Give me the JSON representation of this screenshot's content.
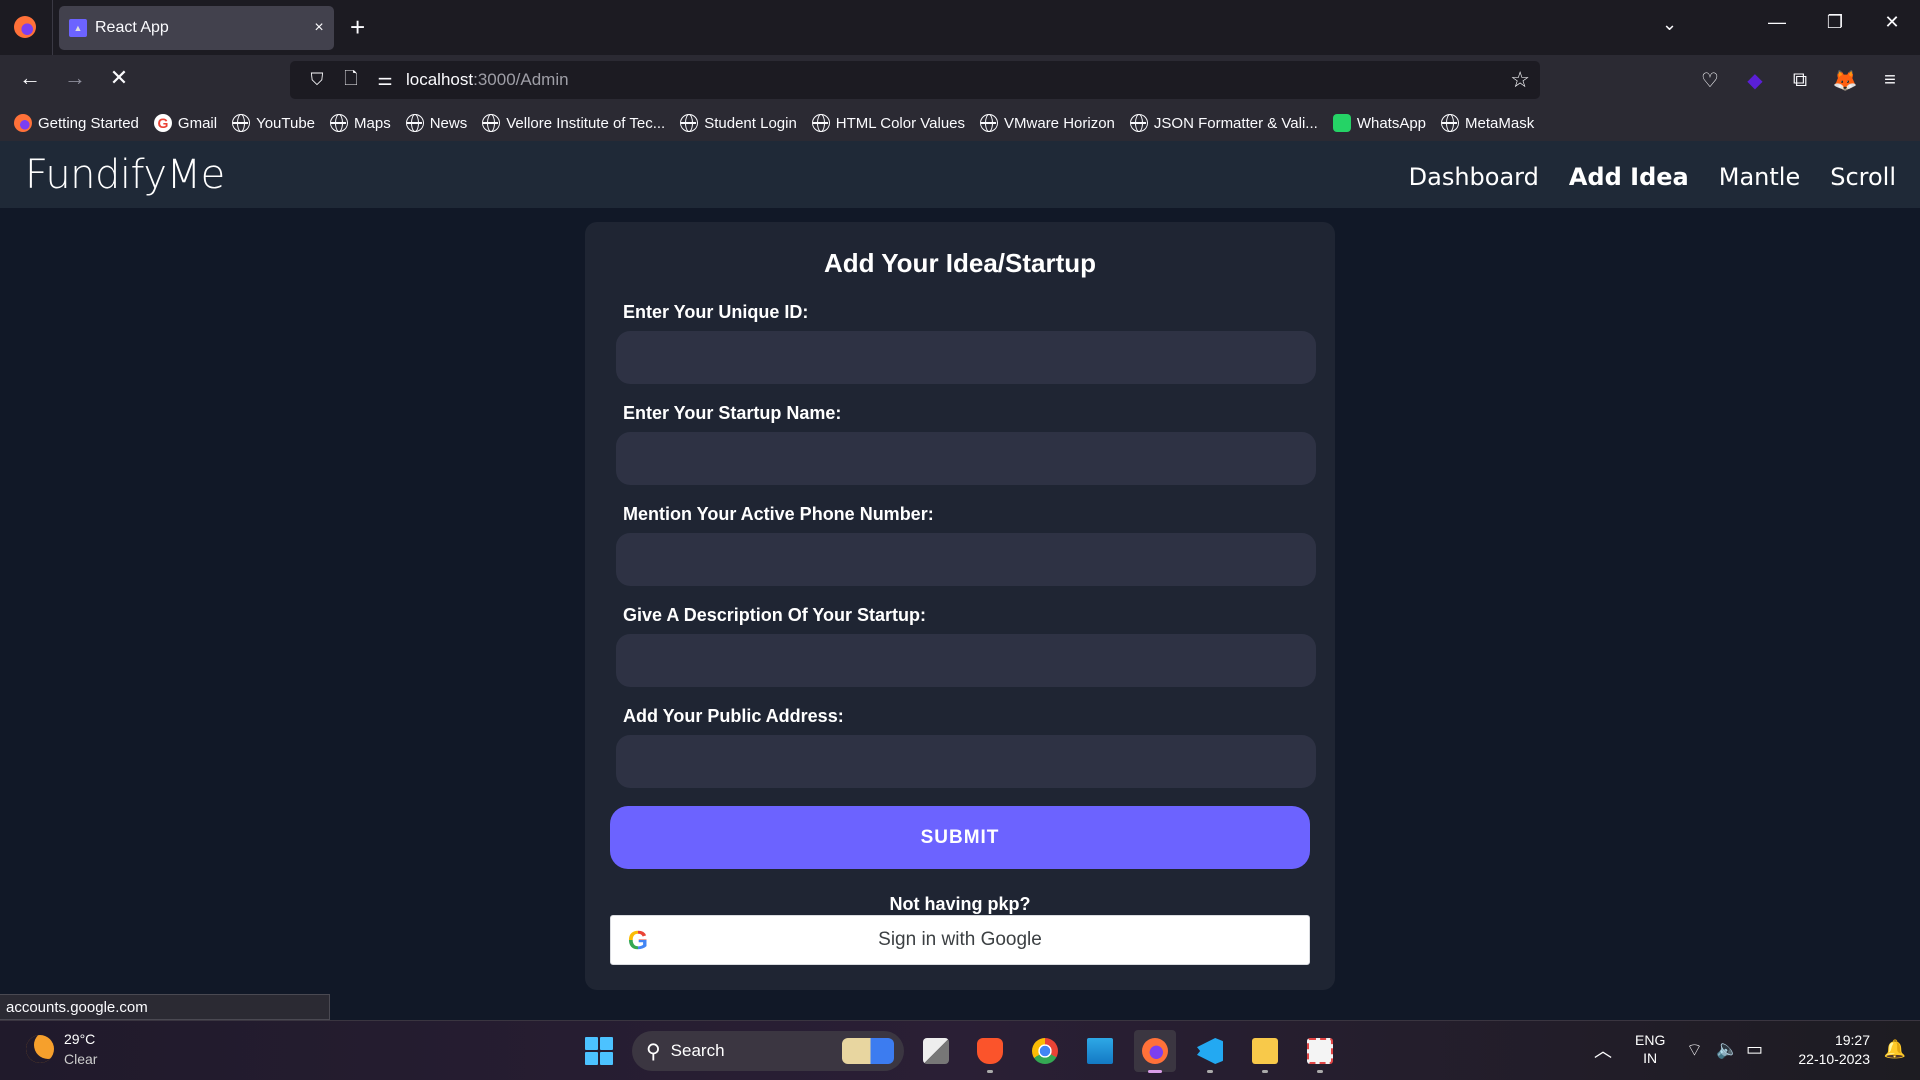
{
  "browser": {
    "tab": {
      "title": "React App",
      "close_icon": "×"
    },
    "new_tab_icon": "+",
    "url": {
      "host": "localhost",
      "path": ":3000/Admin"
    },
    "bookmarks": [
      {
        "label": "Getting Started",
        "icon": "firefox-icon"
      },
      {
        "label": "Gmail",
        "icon": "google-icon"
      },
      {
        "label": "YouTube",
        "icon": "globe-icon"
      },
      {
        "label": "Maps",
        "icon": "globe-icon"
      },
      {
        "label": "News",
        "icon": "globe-icon"
      },
      {
        "label": "Vellore Institute of Tec...",
        "icon": "globe-icon"
      },
      {
        "label": "Student Login",
        "icon": "globe-icon"
      },
      {
        "label": "HTML Color Values",
        "icon": "globe-icon"
      },
      {
        "label": "VMware Horizon",
        "icon": "globe-icon"
      },
      {
        "label": "JSON Formatter & Vali...",
        "icon": "globe-icon"
      },
      {
        "label": "WhatsApp",
        "icon": "whatsapp-icon"
      },
      {
        "label": "MetaMask",
        "icon": "globe-icon"
      }
    ],
    "status_link": "accounts.google.com"
  },
  "app": {
    "brand": "FundifyMe",
    "nav": [
      {
        "label": "Dashboard",
        "active": false
      },
      {
        "label": "Add Idea",
        "active": true
      },
      {
        "label": "Mantle",
        "active": false
      },
      {
        "label": "Scroll",
        "active": false
      }
    ],
    "form": {
      "title": "Add Your Idea/Startup",
      "fields": [
        {
          "label": "Enter Your Unique ID:",
          "value": "",
          "placeholder": ""
        },
        {
          "label": "Enter Your Startup Name:",
          "value": "",
          "placeholder": ""
        },
        {
          "label": "Mention Your Active Phone Number:",
          "value": "",
          "placeholder": ""
        },
        {
          "label": "Give A Description Of Your Startup:",
          "value": "",
          "placeholder": ""
        },
        {
          "label": "Add Your Public Address:",
          "value": "",
          "placeholder": ""
        }
      ],
      "submit_label": "SUBMIT",
      "alt_prompt": "Not having pkp?",
      "google_label": "Sign in with Google",
      "google_glyph": "G"
    }
  },
  "colors": {
    "page_bg": "#111827",
    "header_bg": "#1f2937",
    "card_bg": "#1f2533",
    "input_bg": "#2e3244",
    "accent": "#6c63ff"
  },
  "taskbar": {
    "weather": {
      "temp": "29°C",
      "desc": "Clear"
    },
    "search_label": "Search",
    "apps": [
      "task-view",
      "brave",
      "chrome",
      "remote-desktop",
      "firefox",
      "vscode",
      "file-explorer",
      "snipping-tool"
    ],
    "lang": {
      "line1": "ENG",
      "line2": "IN"
    },
    "time": "19:27",
    "date": "22-10-2023"
  }
}
